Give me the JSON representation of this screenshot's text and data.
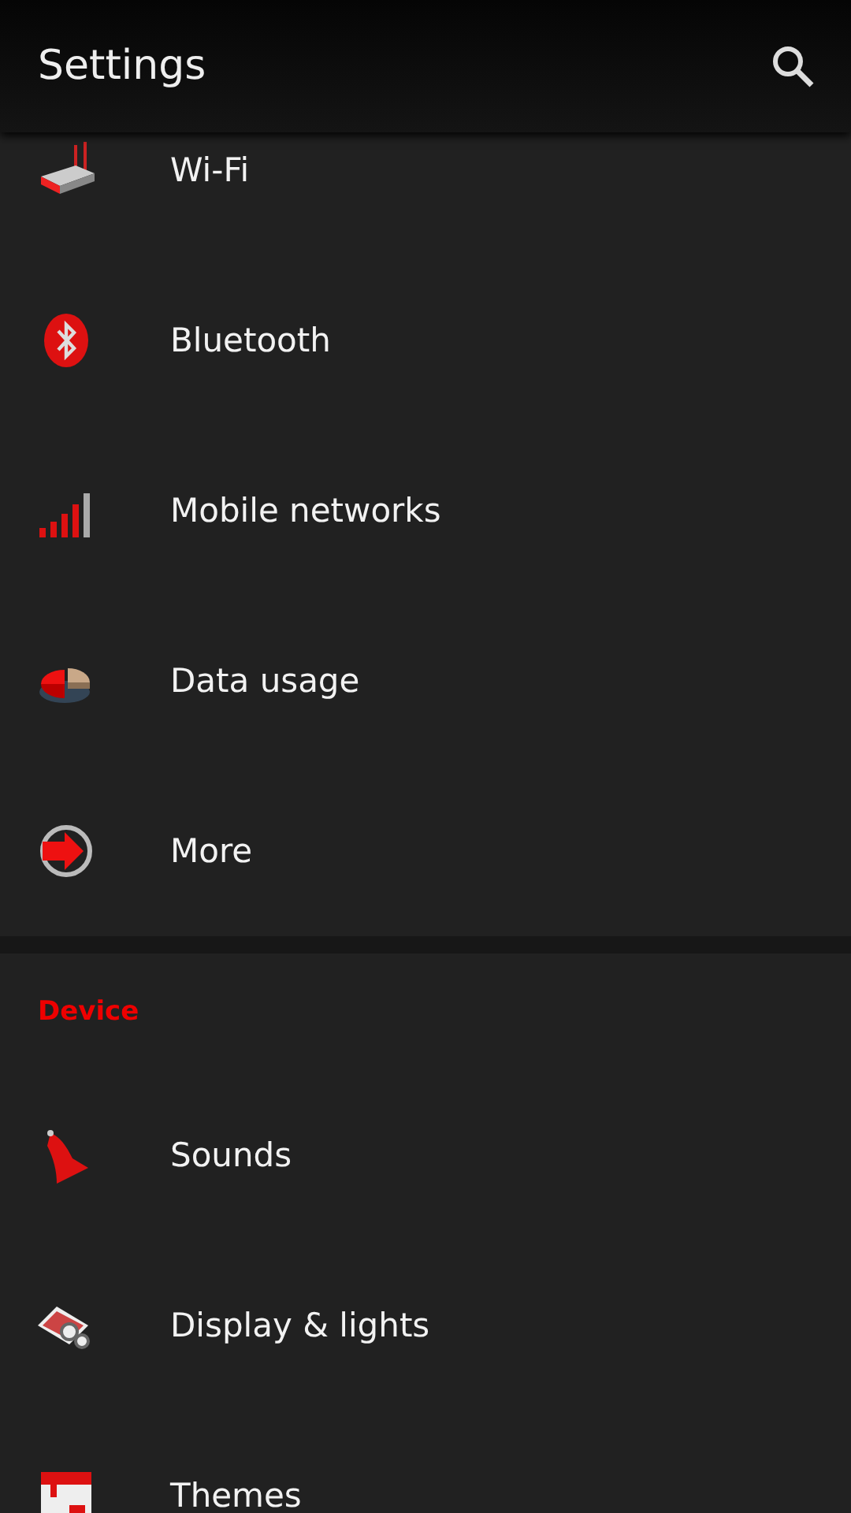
{
  "app_bar": {
    "title": "Settings"
  },
  "sections": [
    {
      "items": [
        {
          "label": "Wi-Fi"
        },
        {
          "label": "Bluetooth"
        },
        {
          "label": "Mobile networks"
        },
        {
          "label": "Data usage"
        },
        {
          "label": "More"
        }
      ]
    },
    {
      "header": "Device",
      "items": [
        {
          "label": "Sounds"
        },
        {
          "label": "Display & lights"
        },
        {
          "label": "Themes"
        }
      ]
    }
  ]
}
